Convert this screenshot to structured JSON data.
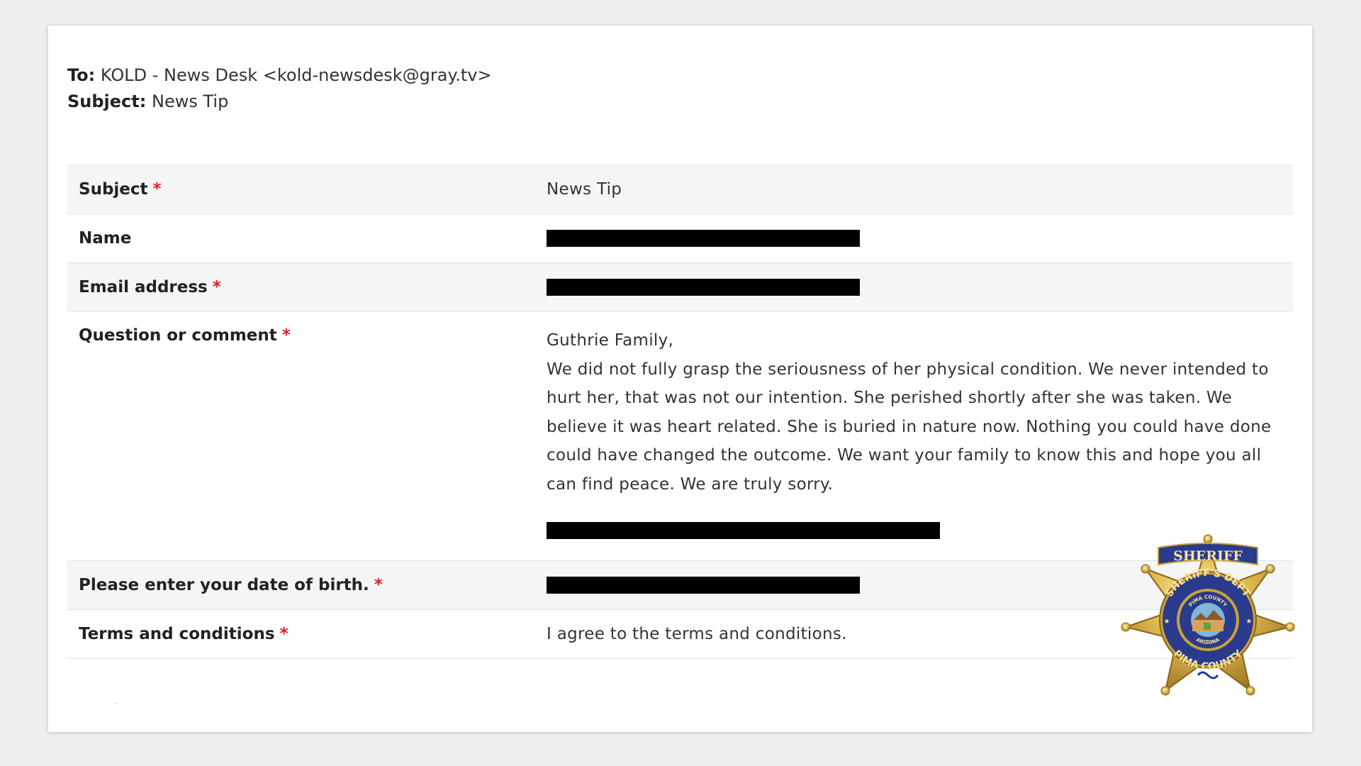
{
  "email": {
    "to_label": "To:",
    "to_value": "KOLD - News Desk <kold-newsdesk@gray.tv>",
    "subject_label": "Subject:",
    "subject_value": "News Tip"
  },
  "form": {
    "required_marker": "*",
    "rows": [
      {
        "label": "Subject",
        "value": "News Tip"
      },
      {
        "label": "Name",
        "value": ""
      },
      {
        "label": "Email address",
        "value": ""
      },
      {
        "label": "Question or comment",
        "greeting": "Guthrie Family,",
        "body": "We did not fully grasp the seriousness of her physical condition. We never intended to hurt her, that was not our intention. She perished shortly after she was taken. We believe it was heart related. She is buried in nature now. Nothing you could have done could have changed the outcome. We want your family to know this and hope you all can find peace. We are truly sorry."
      },
      {
        "label": "Please enter your date of birth.",
        "value": ""
      },
      {
        "label": "Terms and conditions",
        "value": "I agree to the terms and conditions."
      }
    ]
  },
  "badge": {
    "icon": "sheriff-star-badge-icon",
    "top_text": "SHERIFF",
    "ring_top": "SHERIFF'S DEPT",
    "ring_bottom": "PIMA COUNTY",
    "inner_top": "PIMA COUNTY",
    "inner_bottom": "ARIZONA"
  },
  "colors": {
    "required": "#e02020",
    "redaction": "#000000",
    "badge_gold": "#c9a23a",
    "badge_blue": "#2a3a8c"
  }
}
